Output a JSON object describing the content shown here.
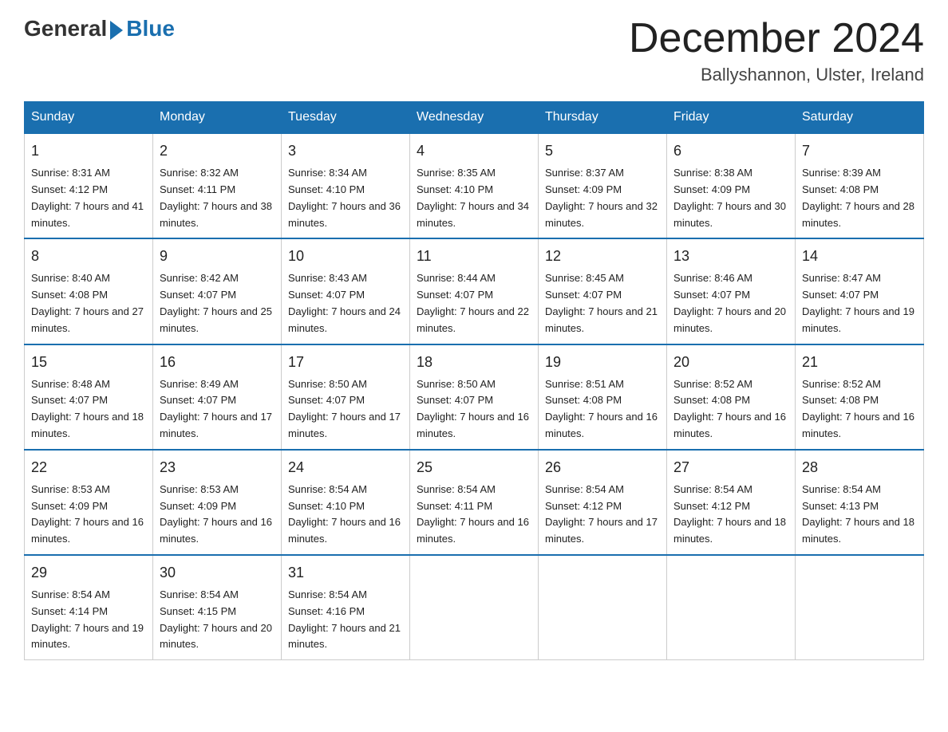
{
  "header": {
    "logo_general": "General",
    "logo_blue": "Blue",
    "month_title": "December 2024",
    "location": "Ballyshannon, Ulster, Ireland"
  },
  "days_of_week": [
    "Sunday",
    "Monday",
    "Tuesday",
    "Wednesday",
    "Thursday",
    "Friday",
    "Saturday"
  ],
  "weeks": [
    [
      {
        "num": "1",
        "sunrise": "8:31 AM",
        "sunset": "4:12 PM",
        "daylight": "7 hours and 41 minutes."
      },
      {
        "num": "2",
        "sunrise": "8:32 AM",
        "sunset": "4:11 PM",
        "daylight": "7 hours and 38 minutes."
      },
      {
        "num": "3",
        "sunrise": "8:34 AM",
        "sunset": "4:10 PM",
        "daylight": "7 hours and 36 minutes."
      },
      {
        "num": "4",
        "sunrise": "8:35 AM",
        "sunset": "4:10 PM",
        "daylight": "7 hours and 34 minutes."
      },
      {
        "num": "5",
        "sunrise": "8:37 AM",
        "sunset": "4:09 PM",
        "daylight": "7 hours and 32 minutes."
      },
      {
        "num": "6",
        "sunrise": "8:38 AM",
        "sunset": "4:09 PM",
        "daylight": "7 hours and 30 minutes."
      },
      {
        "num": "7",
        "sunrise": "8:39 AM",
        "sunset": "4:08 PM",
        "daylight": "7 hours and 28 minutes."
      }
    ],
    [
      {
        "num": "8",
        "sunrise": "8:40 AM",
        "sunset": "4:08 PM",
        "daylight": "7 hours and 27 minutes."
      },
      {
        "num": "9",
        "sunrise": "8:42 AM",
        "sunset": "4:07 PM",
        "daylight": "7 hours and 25 minutes."
      },
      {
        "num": "10",
        "sunrise": "8:43 AM",
        "sunset": "4:07 PM",
        "daylight": "7 hours and 24 minutes."
      },
      {
        "num": "11",
        "sunrise": "8:44 AM",
        "sunset": "4:07 PM",
        "daylight": "7 hours and 22 minutes."
      },
      {
        "num": "12",
        "sunrise": "8:45 AM",
        "sunset": "4:07 PM",
        "daylight": "7 hours and 21 minutes."
      },
      {
        "num": "13",
        "sunrise": "8:46 AM",
        "sunset": "4:07 PM",
        "daylight": "7 hours and 20 minutes."
      },
      {
        "num": "14",
        "sunrise": "8:47 AM",
        "sunset": "4:07 PM",
        "daylight": "7 hours and 19 minutes."
      }
    ],
    [
      {
        "num": "15",
        "sunrise": "8:48 AM",
        "sunset": "4:07 PM",
        "daylight": "7 hours and 18 minutes."
      },
      {
        "num": "16",
        "sunrise": "8:49 AM",
        "sunset": "4:07 PM",
        "daylight": "7 hours and 17 minutes."
      },
      {
        "num": "17",
        "sunrise": "8:50 AM",
        "sunset": "4:07 PM",
        "daylight": "7 hours and 17 minutes."
      },
      {
        "num": "18",
        "sunrise": "8:50 AM",
        "sunset": "4:07 PM",
        "daylight": "7 hours and 16 minutes."
      },
      {
        "num": "19",
        "sunrise": "8:51 AM",
        "sunset": "4:08 PM",
        "daylight": "7 hours and 16 minutes."
      },
      {
        "num": "20",
        "sunrise": "8:52 AM",
        "sunset": "4:08 PM",
        "daylight": "7 hours and 16 minutes."
      },
      {
        "num": "21",
        "sunrise": "8:52 AM",
        "sunset": "4:08 PM",
        "daylight": "7 hours and 16 minutes."
      }
    ],
    [
      {
        "num": "22",
        "sunrise": "8:53 AM",
        "sunset": "4:09 PM",
        "daylight": "7 hours and 16 minutes."
      },
      {
        "num": "23",
        "sunrise": "8:53 AM",
        "sunset": "4:09 PM",
        "daylight": "7 hours and 16 minutes."
      },
      {
        "num": "24",
        "sunrise": "8:54 AM",
        "sunset": "4:10 PM",
        "daylight": "7 hours and 16 minutes."
      },
      {
        "num": "25",
        "sunrise": "8:54 AM",
        "sunset": "4:11 PM",
        "daylight": "7 hours and 16 minutes."
      },
      {
        "num": "26",
        "sunrise": "8:54 AM",
        "sunset": "4:12 PM",
        "daylight": "7 hours and 17 minutes."
      },
      {
        "num": "27",
        "sunrise": "8:54 AM",
        "sunset": "4:12 PM",
        "daylight": "7 hours and 18 minutes."
      },
      {
        "num": "28",
        "sunrise": "8:54 AM",
        "sunset": "4:13 PM",
        "daylight": "7 hours and 18 minutes."
      }
    ],
    [
      {
        "num": "29",
        "sunrise": "8:54 AM",
        "sunset": "4:14 PM",
        "daylight": "7 hours and 19 minutes."
      },
      {
        "num": "30",
        "sunrise": "8:54 AM",
        "sunset": "4:15 PM",
        "daylight": "7 hours and 20 minutes."
      },
      {
        "num": "31",
        "sunrise": "8:54 AM",
        "sunset": "4:16 PM",
        "daylight": "7 hours and 21 minutes."
      },
      null,
      null,
      null,
      null
    ]
  ]
}
